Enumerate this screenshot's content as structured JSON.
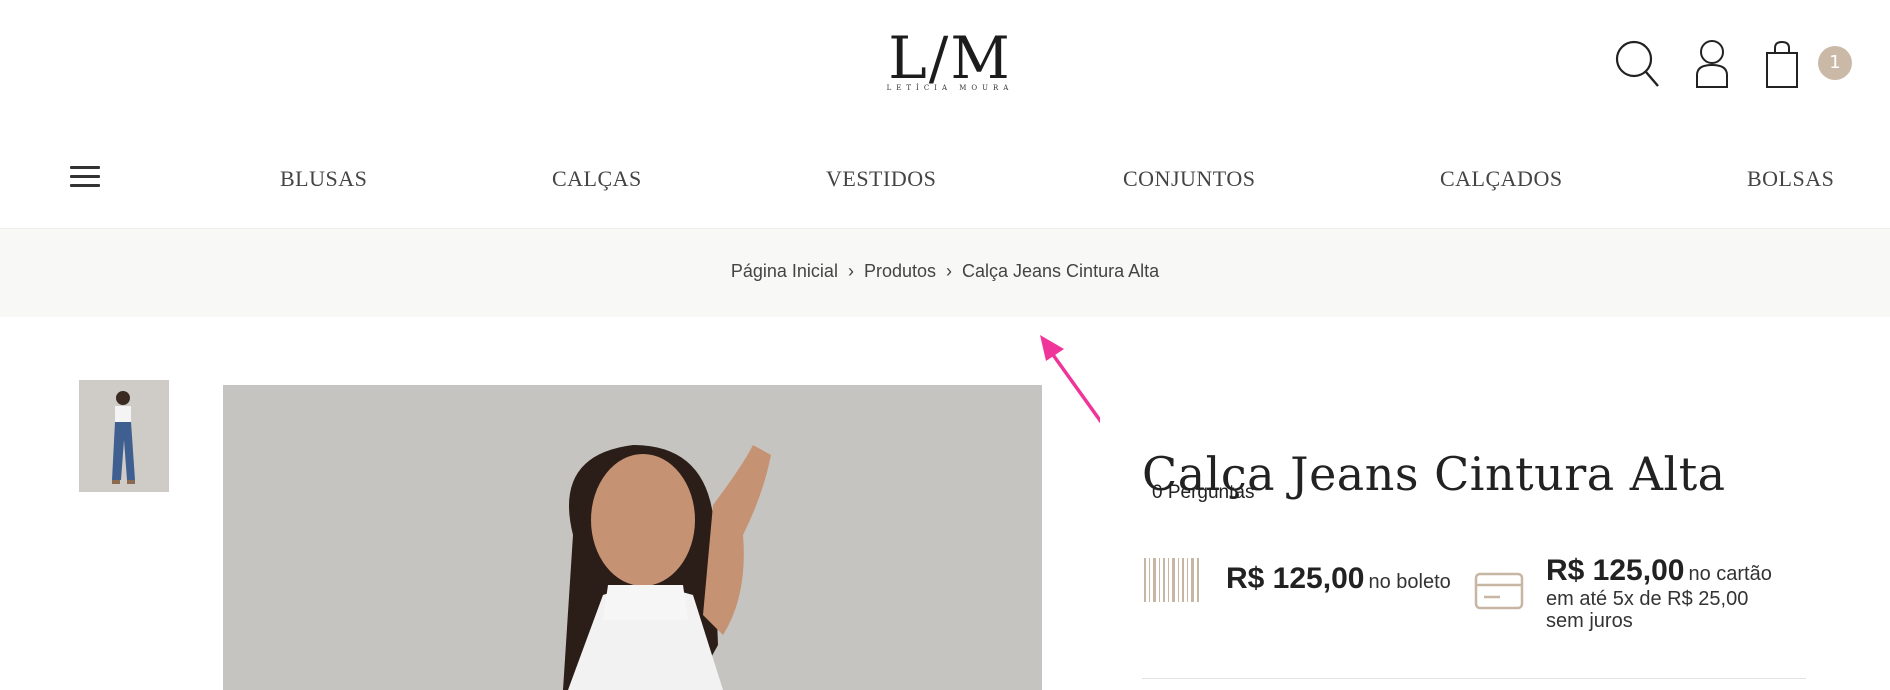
{
  "brand": {
    "logo_mark": "L/M",
    "logo_sub": "LETÍCIA MOURA"
  },
  "header": {
    "cart_count": "1",
    "icons": [
      "search-icon",
      "user-icon",
      "bag-icon"
    ]
  },
  "nav": {
    "items": [
      {
        "label": "BLUSAS"
      },
      {
        "label": "CALÇAS"
      },
      {
        "label": "VESTIDOS"
      },
      {
        "label": "CONJUNTOS"
      },
      {
        "label": "CALÇADOS"
      },
      {
        "label": "BOLSAS"
      }
    ]
  },
  "breadcrumb": {
    "items": [
      "Página Inicial",
      "Produtos",
      "Calça Jeans Cintura Alta"
    ]
  },
  "product": {
    "title": "Calça Jeans Cintura Alta",
    "questions": "0 Perguntas",
    "boleto_price": "R$ 125,00",
    "boleto_note": "no boleto",
    "card_price": "R$ 125,00",
    "card_note": "no cartão",
    "card_installments": "em até 5x de R$ 25,00",
    "card_interest": "sem juros"
  },
  "colors": {
    "badge": "#cbb9a8",
    "accent_icon": "#c8b6a4",
    "annotation_arrow": "#f0359a"
  }
}
